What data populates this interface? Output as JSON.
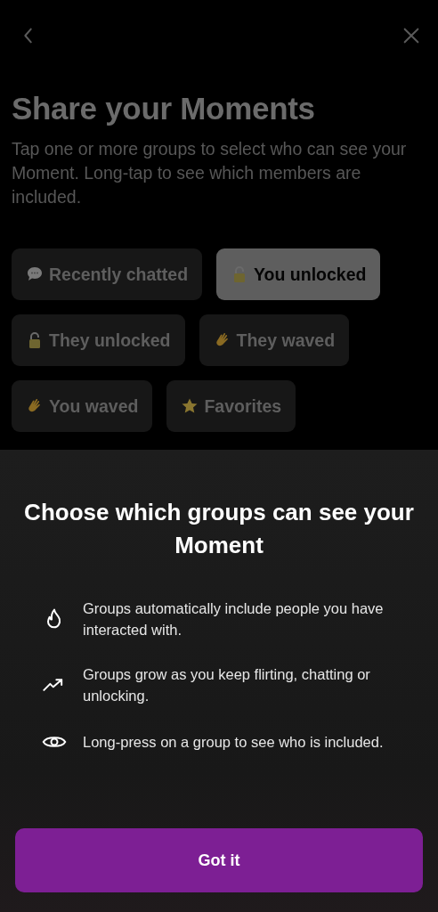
{
  "header": {
    "title": "Share your Moments",
    "subtitle": "Tap one or more groups to select who can see your Moment. Long-tap to see which members are included."
  },
  "groups": [
    {
      "label": "Recently chatted",
      "kind": "chat",
      "selected": false
    },
    {
      "label": "You unlocked",
      "kind": "lock",
      "selected": true
    },
    {
      "label": "They unlocked",
      "kind": "lock",
      "selected": false
    },
    {
      "label": "They waved",
      "kind": "wave",
      "selected": false
    },
    {
      "label": "You waved",
      "kind": "wave",
      "selected": false
    },
    {
      "label": "Favorites",
      "kind": "star",
      "selected": false
    }
  ],
  "sheet": {
    "title": "Choose which groups can see your Moment",
    "tips": [
      {
        "kind": "flame",
        "text": "Groups automatically include people you have interacted with."
      },
      {
        "kind": "trend",
        "text": "Groups grow as you keep flirting, chatting or unlocking."
      },
      {
        "kind": "eye",
        "text": "Long-press on a group to see who is included."
      }
    ],
    "button": "Got it"
  }
}
